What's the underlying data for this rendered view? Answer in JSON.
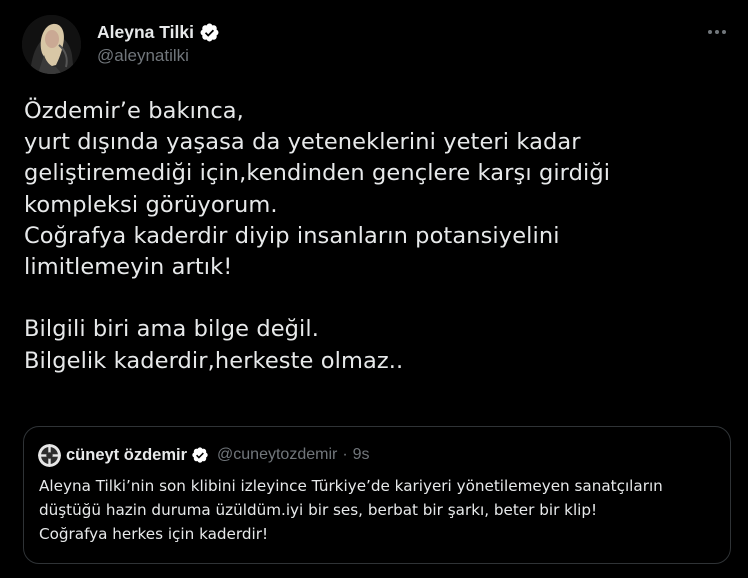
{
  "author": {
    "display_name": "Aleyna Tilki",
    "handle": "@aleynatilki",
    "verified_icon": "verified-badge-icon",
    "avatar_icon": "profile-photo"
  },
  "more_icon": "more-dots-icon",
  "tweet": {
    "lines": [
      "Özdemir’e bakınca,",
      "yurt dışında yaşasa da yeteneklerini yeteri kadar",
      "geliştiremediği için,kendinden gençlere karşı girdiği",
      "kompleksi görüyorum.",
      "Coğrafya kaderdir diyip insanların potansiyelini",
      "limitlemeyin artık!",
      "",
      "Bilgili biri ama bilge değil.",
      "Bilgelik kaderdir,herkeste olmaz.."
    ]
  },
  "quoted_tweet": {
    "display_name": "cüneyt özdemir",
    "handle": "@cuneytozdemir",
    "separator": "·",
    "time": "9s",
    "lines": [
      "Aleyna Tilki’nin son klibini izleyince Türkiye’de kariyeri yönetilemeyen sanatçıların",
      "düştüğü hazin duruma üzüldüm.iyi bir ses, berbat bir şarkı, beter bir klip!",
      "Coğrafya herkes için kaderdir!"
    ]
  },
  "colors": {
    "background": "#000000",
    "text_primary": "#e7e9ea",
    "text_secondary": "#71767b",
    "verified": "#ffffff",
    "border": "#2f3336"
  }
}
